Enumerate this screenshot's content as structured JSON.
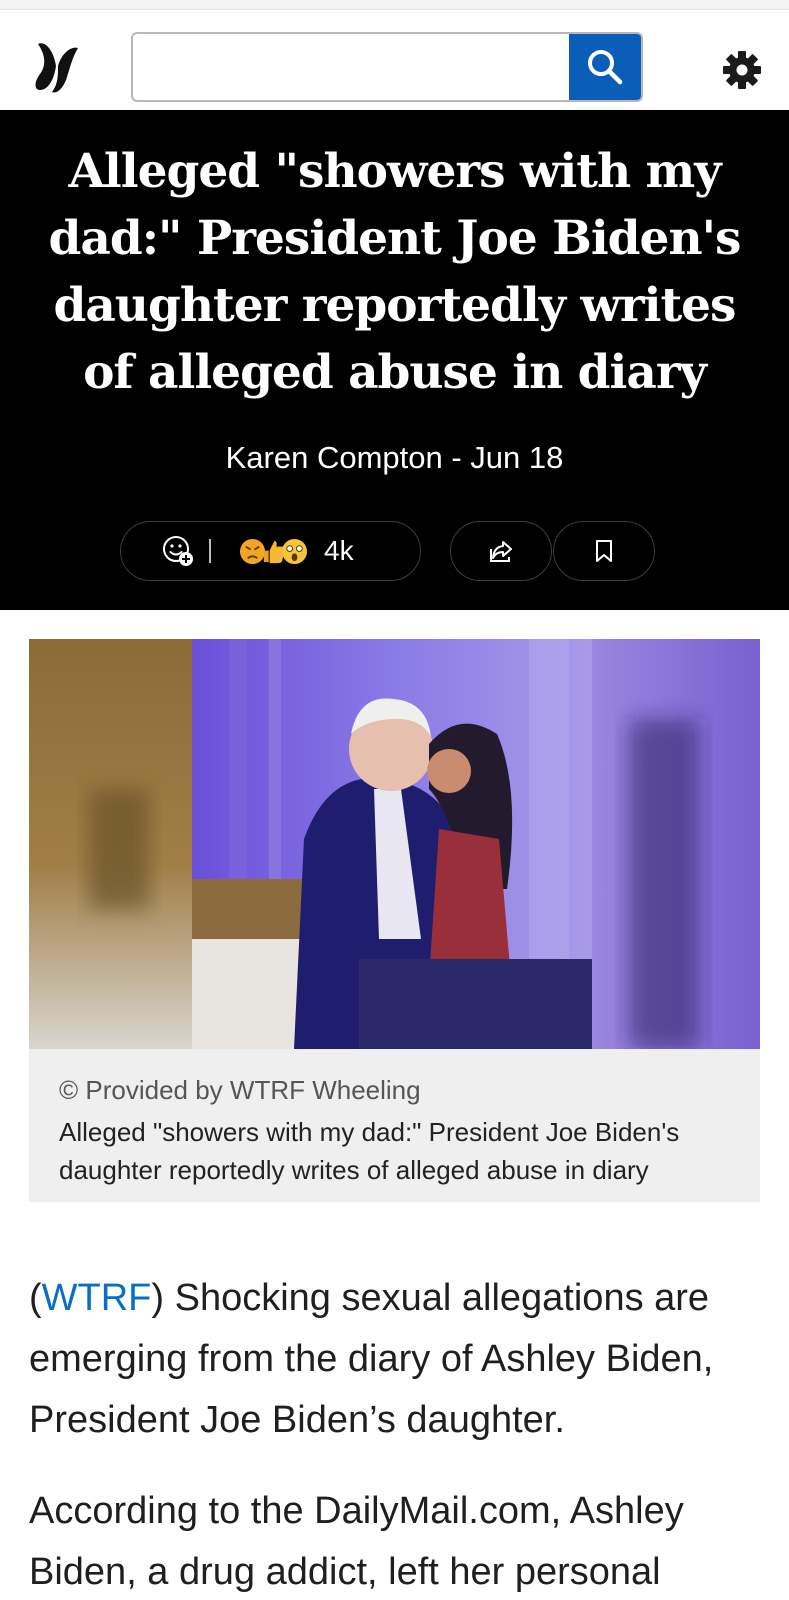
{
  "search": {
    "placeholder": "",
    "value": ""
  },
  "article": {
    "title": "Alleged \"showers with my dad:\" President Joe Biden's daughter reportedly writes of alleged abuse in diary",
    "byline": "Karen Compton - Jun 18",
    "reactions": {
      "count": "4k",
      "emojis": [
        "angry-emoji",
        "thumbs-up-emoji",
        "surprised-emoji"
      ]
    }
  },
  "image": {
    "credit": "© Provided by WTRF Wheeling",
    "caption": "Alleged \"showers with my dad:\" President Joe Biden's daughter reportedly writes of alleged abuse in diary"
  },
  "body": {
    "paragraph1": {
      "open_paren": "(",
      "link": "WTRF",
      "text": ") Shocking sexual allegations are emerging from the diary of Ashley Biden, President Joe Biden’s daughter."
    },
    "paragraph2": "According to the DailyMail.com, Ashley Biden, a drug addict, left her personal"
  },
  "colors": {
    "accent": "#0a5eb8",
    "link": "#0a6ec7",
    "hero_bg": "#000000"
  }
}
